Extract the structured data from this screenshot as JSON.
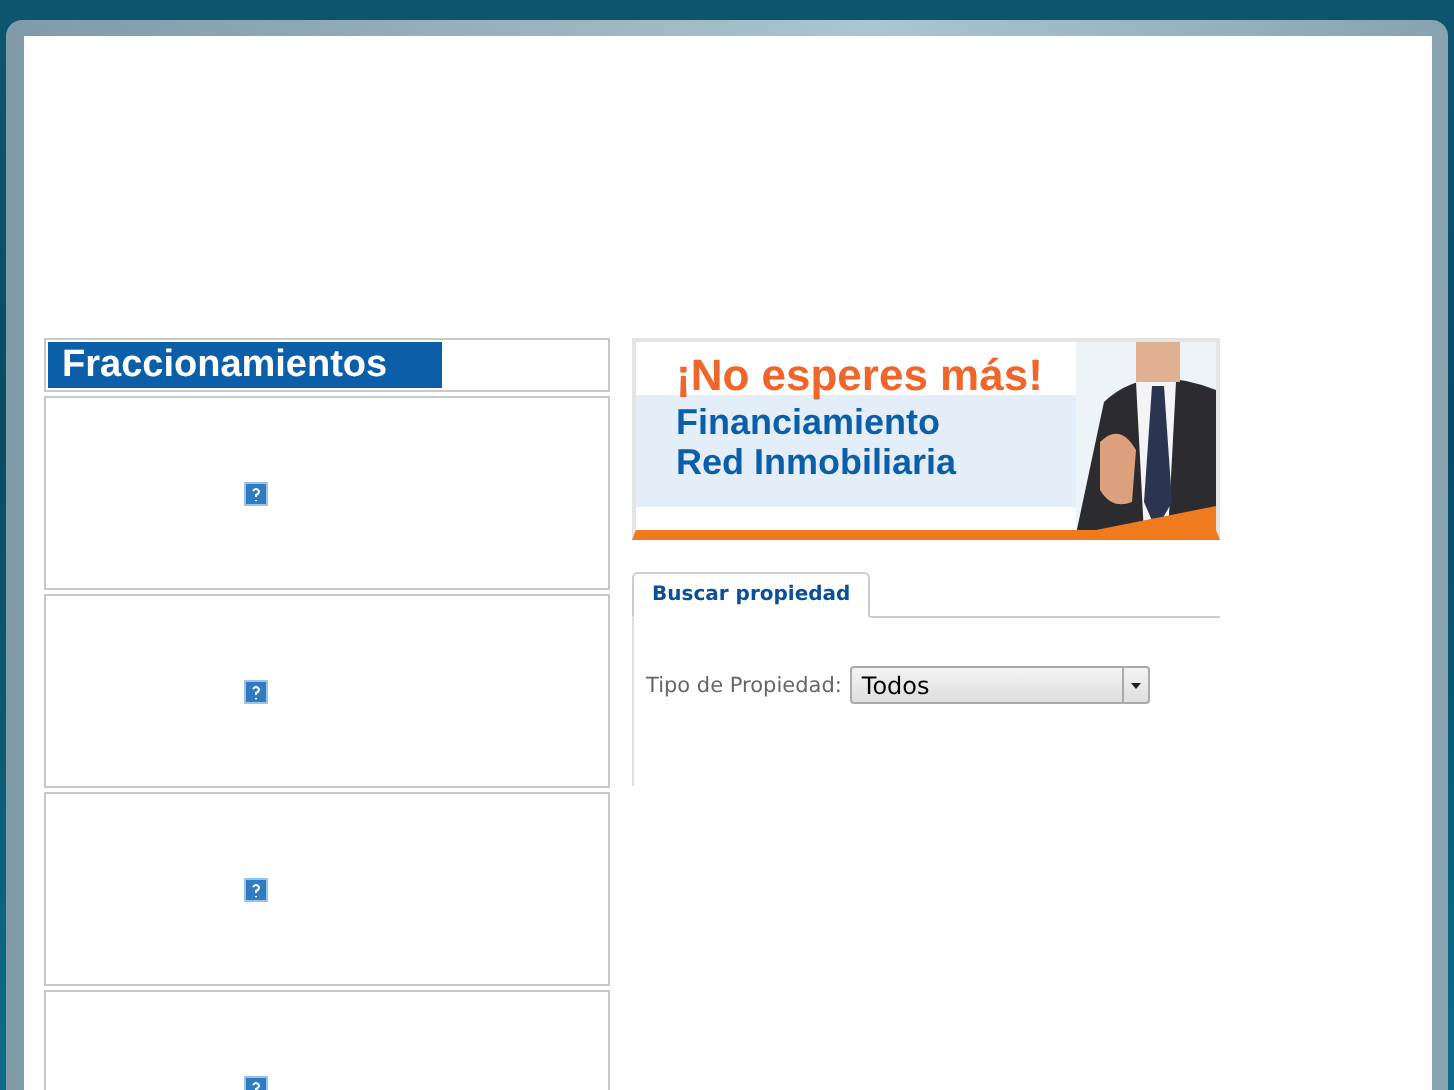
{
  "sidebar": {
    "title": "Fraccionamientos",
    "listings": [
      {
        "kind": "broken_image"
      },
      {
        "kind": "broken_image"
      },
      {
        "kind": "broken_image"
      },
      {
        "kind": "broken_image"
      }
    ]
  },
  "banner": {
    "headline": "¡No esperes más!",
    "lines": [
      "Financiamiento",
      "Red Inmobiliaria"
    ]
  },
  "tabs": [
    {
      "label": "Buscar propiedad",
      "selected": true
    }
  ],
  "search": {
    "label": "Tipo de Propiedad:",
    "property_type": "Todos"
  }
}
